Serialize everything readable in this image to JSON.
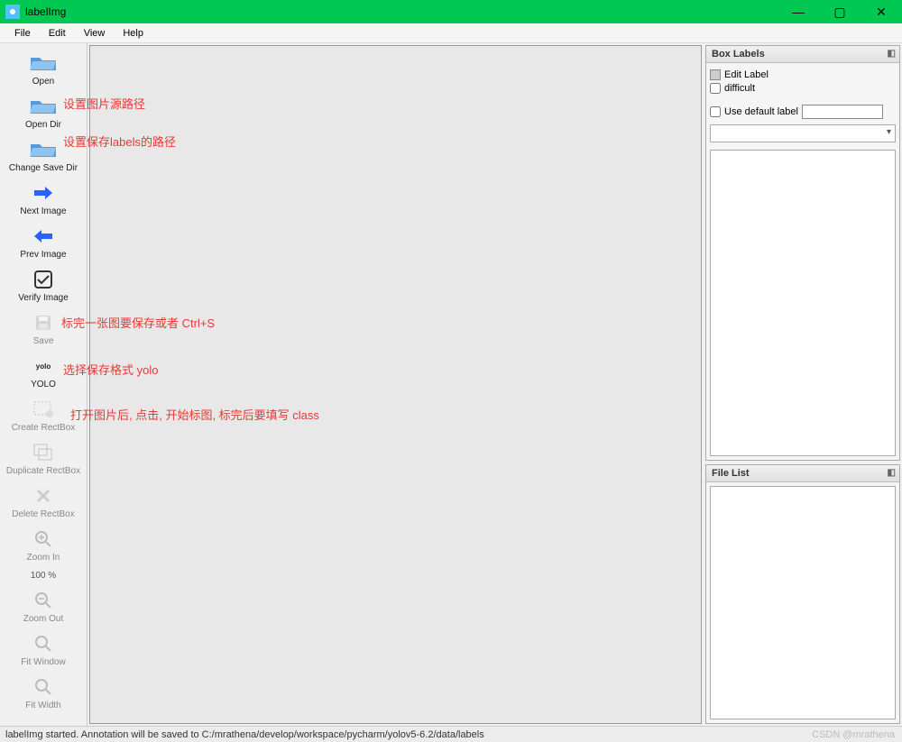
{
  "window": {
    "title": "labelImg"
  },
  "menu": {
    "file": "File",
    "edit": "Edit",
    "view": "View",
    "help": "Help"
  },
  "toolbar": {
    "open": "Open",
    "open_dir": "Open Dir",
    "change_save_dir": "Change Save Dir",
    "next_image": "Next Image",
    "prev_image": "Prev Image",
    "verify_image": "Verify Image",
    "save": "Save",
    "format": "YOLO",
    "format_small": "yolo",
    "create_rect": "Create RectBox",
    "duplicate_rect": "Duplicate RectBox",
    "delete_rect": "Delete RectBox",
    "zoom_in": "Zoom In",
    "zoom_pct": "100 %",
    "zoom_out": "Zoom Out",
    "fit_window": "Fit Window",
    "fit_width": "Fit Width"
  },
  "panels": {
    "box_labels_title": "Box Labels",
    "edit_label": "Edit Label",
    "difficult": "difficult",
    "use_default_label": "Use default label",
    "file_list_title": "File List"
  },
  "annotations": {
    "a1": "设置图片源路径",
    "a2": "设置保存labels的路径",
    "a3": "标完一张图要保存或者 Ctrl+S",
    "a4": "选择保存格式 yolo",
    "a5": "打开图片后, 点击, 开始标图, 标完后要填写 class"
  },
  "status": "labelImg started. Annotation will be saved to C:/mrathena/develop/workspace/pycharm/yolov5-6.2/data/labels",
  "watermark": "CSDN @mrathena"
}
